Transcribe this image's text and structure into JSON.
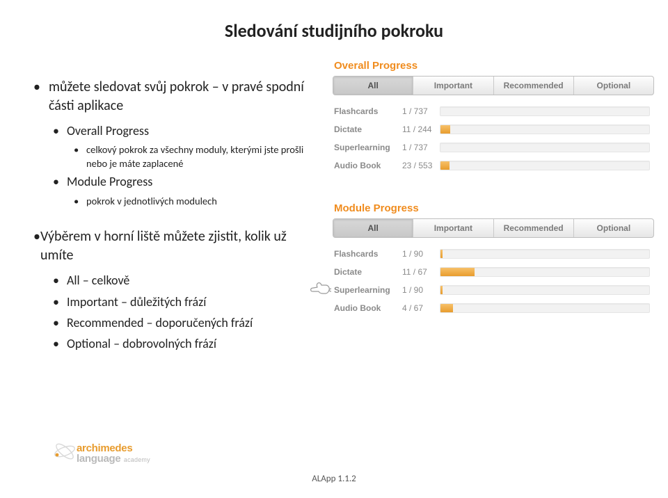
{
  "title": "Sledování studijního pokroku",
  "left": {
    "b0": "můžete sledovat svůj pokrok – v pravé spodní části aplikace",
    "b1a": "Overall Progress",
    "b2a": "celkový pokrok za všechny moduly, kterými jste prošli nebo je máte zaplacené",
    "b1b": "Module Progress",
    "b2b": "pokrok v jednotlivých modulech",
    "p2": "Výběrem v horní liště můžete zjistit, kolik už umíte",
    "c1": "All – celkově",
    "c2": "Important – důležitých frází",
    "c3": "Recommended – doporučených frází",
    "c4": "Optional – dobrovolných frází"
  },
  "tabs": {
    "all": "All",
    "important": "Important",
    "recommended": "Recommended",
    "optional": "Optional"
  },
  "overall": {
    "title": "Overall Progress",
    "rows": [
      {
        "label": "Flashcards",
        "count": "1 / 737",
        "pct": 0.14
      },
      {
        "label": "Dictate",
        "count": "11 / 244",
        "pct": 4.5
      },
      {
        "label": "Superlearning",
        "count": "1 / 737",
        "pct": 0.14
      },
      {
        "label": "Audio Book",
        "count": "23 / 553",
        "pct": 4.2
      }
    ]
  },
  "module": {
    "title": "Module Progress",
    "rows": [
      {
        "label": "Flashcards",
        "count": "1 / 90",
        "pct": 1.1
      },
      {
        "label": "Dictate",
        "count": "11 / 67",
        "pct": 16.4
      },
      {
        "label": "Superlearning",
        "count": "1 / 90",
        "pct": 1.1
      },
      {
        "label": "Audio Book",
        "count": "4 / 67",
        "pct": 6.0
      }
    ]
  },
  "footer": {
    "line1": "archimedes",
    "line2": "language",
    "line3": "academy",
    "page": "ALApp 1.1.2"
  }
}
